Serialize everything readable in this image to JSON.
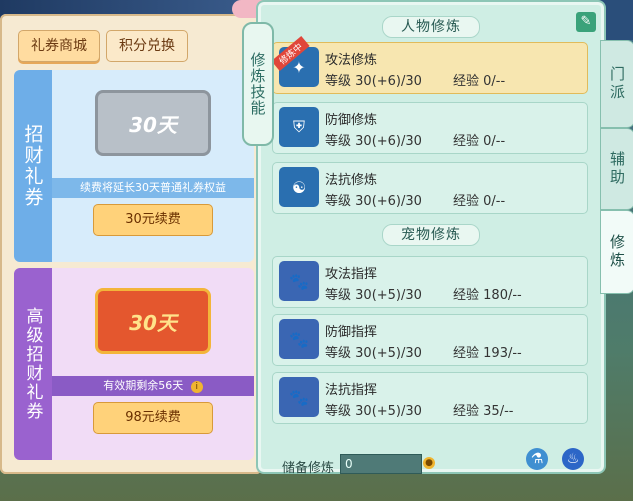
{
  "shop": {
    "tabs": [
      "礼券商城",
      "积分兑换"
    ],
    "cards": [
      {
        "side_label": "招财礼券",
        "ticket_label": "30天",
        "description": "续费将延长30天普通礼券权益",
        "buy_label": "30元续费"
      },
      {
        "side_label": "高级招财礼券",
        "ticket_label": "30天",
        "description": "有效期剩余56天",
        "buy_label": "98元续费"
      }
    ]
  },
  "cultivation": {
    "vertical_tab": "修炼技能",
    "sections": [
      {
        "title": "人物修炼",
        "items": [
          {
            "name": "攻法修炼",
            "level_label": "等级",
            "level": "30(+6)/30",
            "exp_label": "经验",
            "exp": "0/--",
            "badge": "修炼中",
            "icon": "attack-magic-icon"
          },
          {
            "name": "防御修炼",
            "level_label": "等级",
            "level": "30(+6)/30",
            "exp_label": "经验",
            "exp": "0/--",
            "icon": "defense-icon"
          },
          {
            "name": "法抗修炼",
            "level_label": "等级",
            "level": "30(+6)/30",
            "exp_label": "经验",
            "exp": "0/--",
            "icon": "magic-resist-icon"
          }
        ]
      },
      {
        "title": "宠物修炼",
        "items": [
          {
            "name": "攻法指挥",
            "level_label": "等级",
            "level": "30(+5)/30",
            "exp_label": "经验",
            "exp": "180/--",
            "icon": "pet-attack-icon"
          },
          {
            "name": "防御指挥",
            "level_label": "等级",
            "level": "30(+5)/30",
            "exp_label": "经验",
            "exp": "193/--",
            "icon": "pet-defense-icon"
          },
          {
            "name": "法抗指挥",
            "level_label": "等级",
            "level": "30(+5)/30",
            "exp_label": "经验",
            "exp": "35/--",
            "icon": "pet-resist-icon"
          }
        ]
      }
    ],
    "reserve_label": "储备修炼",
    "reserve_value": "0",
    "side_tabs": [
      "门派",
      "辅助",
      "修炼"
    ]
  },
  "colors": {
    "accent_gold": "#ffd27a",
    "panel_mint": "#cfeee4",
    "card_blue": "#6eaee8",
    "card_purple": "#9a62cf"
  }
}
